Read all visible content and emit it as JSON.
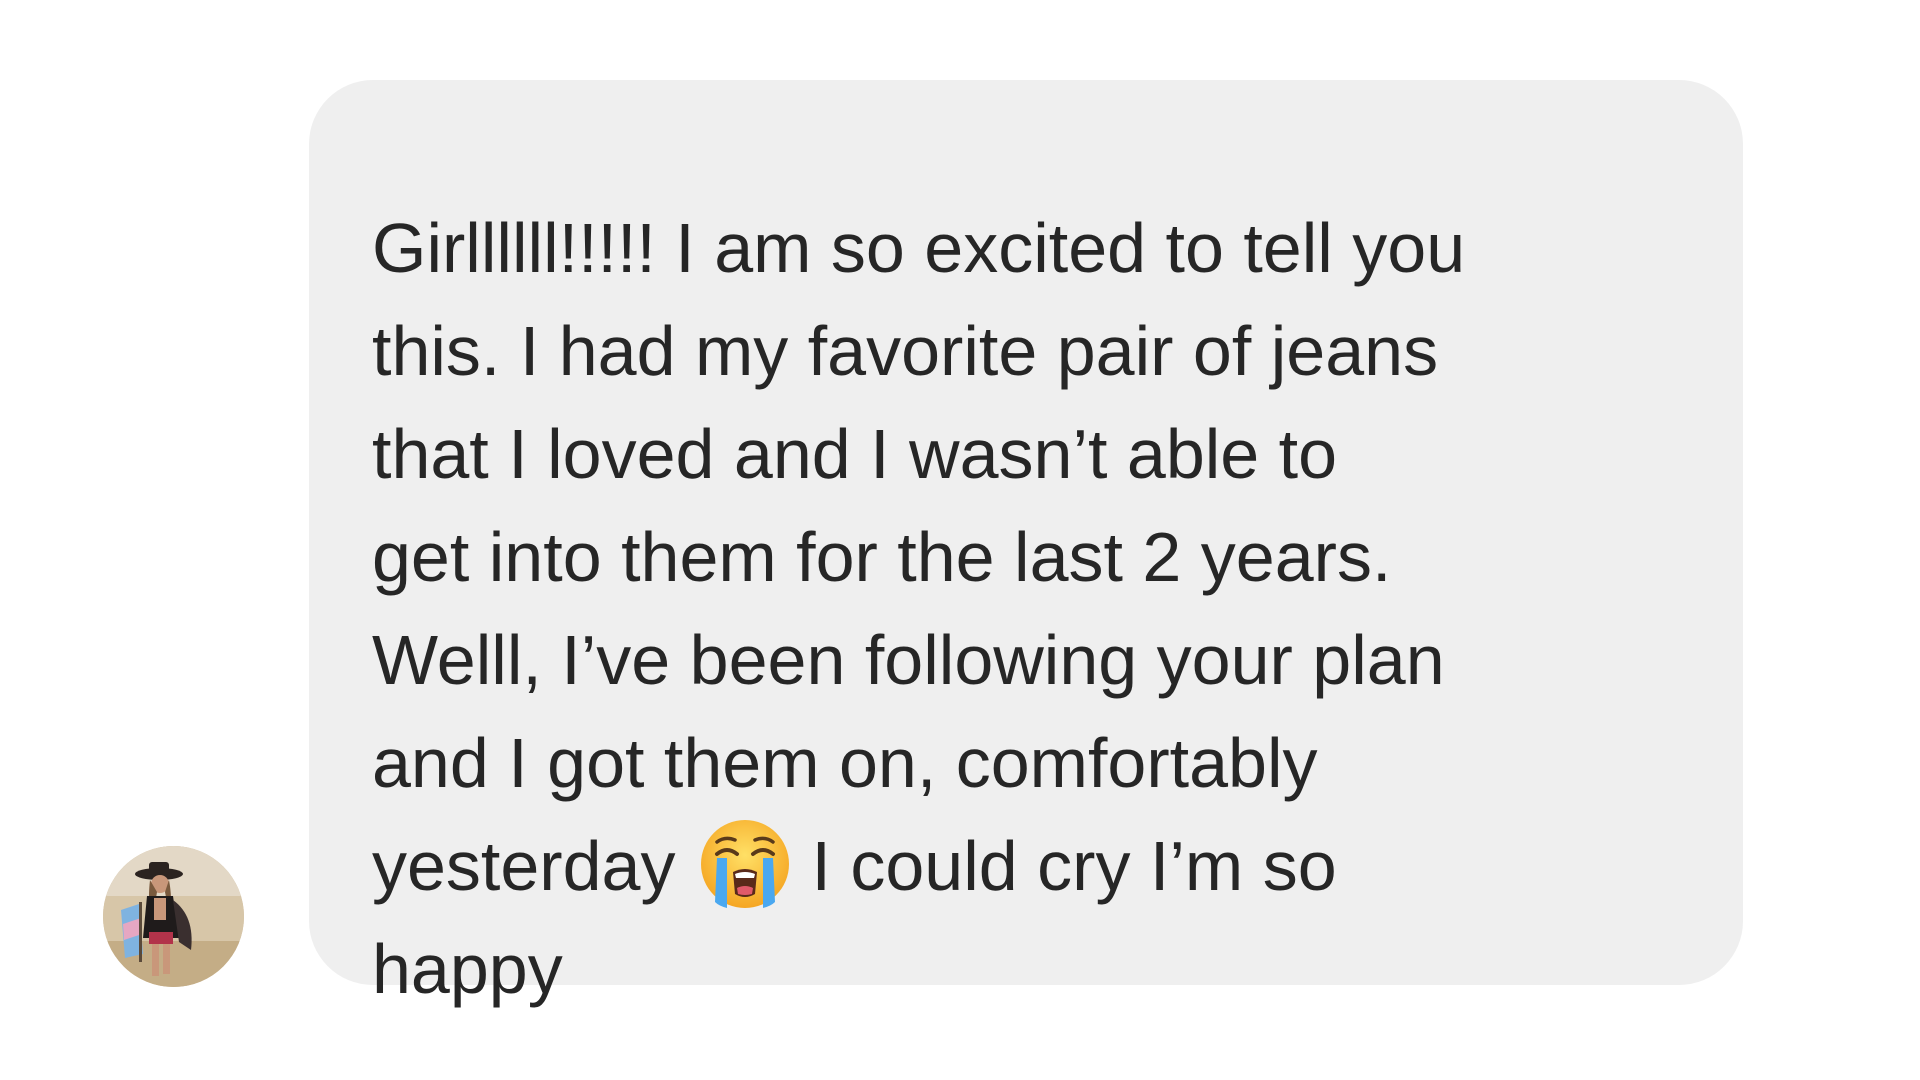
{
  "conversation": {
    "message": {
      "lines": [
        "Girllllll!!!!! I am so excited to tell you",
        "this. I had my favorite pair of jeans",
        "that I loved and I wasn’t able to",
        "get into them for the last 2 years.",
        "Welll, I’ve been following your plan",
        "and I got them on, comfortably",
        "yesterday",
        "I could cry I’m so",
        "happy"
      ],
      "emoji": "loudly-crying-face-icon"
    },
    "sender": {
      "avatar_icon": "profile-photo-avatar"
    }
  },
  "colors": {
    "bubble_background": "#efefef",
    "text": "#262626",
    "page_background": "#ffffff"
  }
}
